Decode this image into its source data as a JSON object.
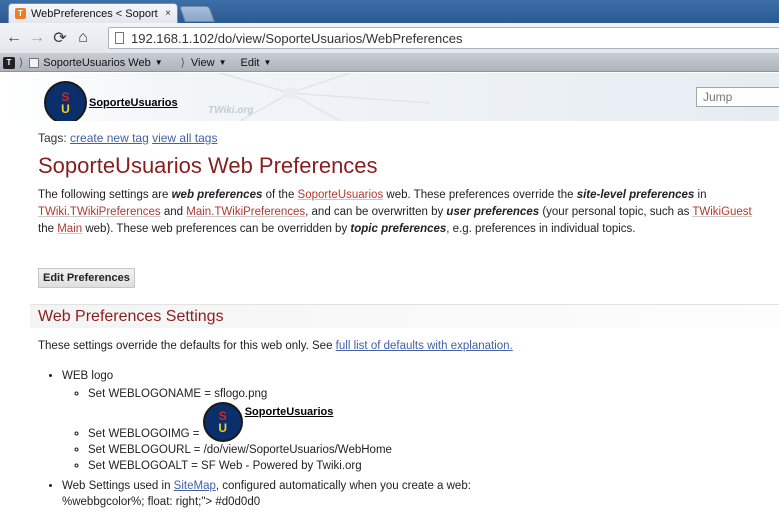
{
  "browser": {
    "tab_title": "WebPreferences < Soport",
    "tab_close": "×",
    "favicon_letter": "T",
    "url": "192.168.1.102/do/view/SoporteUsuarios/WebPreferences"
  },
  "wikibar": {
    "web_label": "SoporteUsuarios Web",
    "view_label": "View",
    "edit_label": "Edit"
  },
  "header": {
    "logo_s": "S",
    "logo_u": "U",
    "logo_text": "SoporteUsuarios",
    "twiki_org": "TWiki.org",
    "jump_placeholder": "Jump"
  },
  "content": {
    "tags_label": "Tags:",
    "create_tag": "create new tag",
    "view_tags": "view all tags",
    "title": "SoporteUsuarios Web Preferences",
    "intro1_a": "The following settings are ",
    "intro1_b": "web preferences",
    "intro1_c": " of the ",
    "intro1_link": "SoporteUsuarios",
    "intro1_d": " web. These preferences override the ",
    "intro1_e": "site-level preferences",
    "intro1_f": " in",
    "intro2_link1": "TWiki.TWikiPreferences",
    "intro2_a": " and ",
    "intro2_link2": "Main.TWikiPreferences",
    "intro2_b": ", and can be overwritten by ",
    "intro2_c": "user preferences",
    "intro2_d": " (your personal topic, such as ",
    "intro2_link3": "TWikiGuest",
    "intro3_a": "the ",
    "intro3_link": "Main",
    "intro3_b": " web). These web preferences can be overridden by ",
    "intro3_c": "topic preferences",
    "intro3_d": ", e.g. preferences in individual topics.",
    "edit_button": "Edit Preferences",
    "section_title": "Web Preferences Settings",
    "settings_intro": "These settings override the defaults for this web only. See ",
    "settings_link": "full list of defaults with explanation.",
    "web_logo": "WEB logo",
    "setting_logoname": "Set WEBLOGONAME = sflogo.png",
    "setting_logoimg": "Set WEBLOGOIMG = ",
    "setting_logourl": "Set WEBLOGOURL = /do/view/SoporteUsuarios/WebHome",
    "setting_logoalt": "Set WEBLOGOALT = SF Web - Powered by Twiki.org",
    "sitemap_a": "Web Settings used in ",
    "sitemap_link": "SiteMap",
    "sitemap_b": ", configured automatically when you create a web:",
    "sitemap_line2": "%webbgcolor%; float: right;\"> #d0d0d0"
  }
}
